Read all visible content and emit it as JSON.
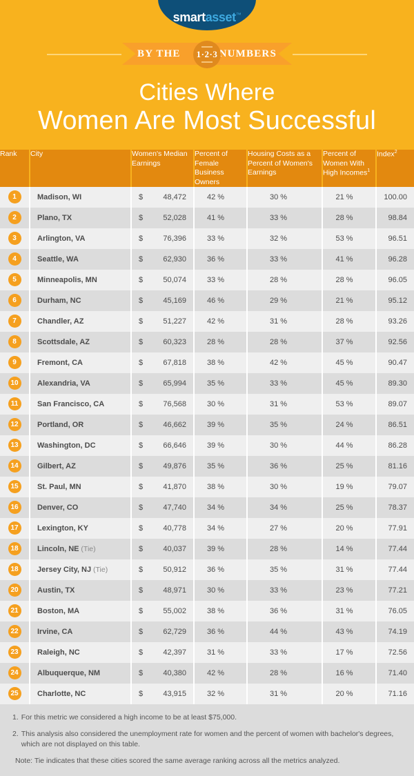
{
  "brand": {
    "logo_first": "smart",
    "logo_second": "asset",
    "logo_tm": "™",
    "navy": "#0e4f78",
    "light_blue": "#3ea9e0"
  },
  "ribbon": {
    "left_label": "BY THE",
    "right_label": "NUMBERS",
    "badge_number": "1·2·3"
  },
  "title": {
    "line1": "Cities Where",
    "line2": "Women Are Most Successful"
  },
  "table": {
    "headers": {
      "rank": "Rank",
      "city": "City",
      "earnings": "Women's Median Earnings",
      "business": "Percent of Female Business Owners",
      "housing": "Housing Costs as a Percent of Women's Earnings",
      "high_income": "Percent of Women With High Incomes",
      "high_income_sup": "1",
      "index": "Index",
      "index_sup": "2"
    },
    "currency_symbol": "$",
    "rows": [
      {
        "rank": "1",
        "city": "Madison, WI",
        "tie": "",
        "earnings": "48,472",
        "business": "42 %",
        "housing": "30 %",
        "high_income": "21 %",
        "index": "100.00"
      },
      {
        "rank": "2",
        "city": "Plano, TX",
        "tie": "",
        "earnings": "52,028",
        "business": "41 %",
        "housing": "33 %",
        "high_income": "28 %",
        "index": "98.84"
      },
      {
        "rank": "3",
        "city": "Arlington, VA",
        "tie": "",
        "earnings": "76,396",
        "business": "33 %",
        "housing": "32 %",
        "high_income": "53 %",
        "index": "96.51"
      },
      {
        "rank": "4",
        "city": "Seattle, WA",
        "tie": "",
        "earnings": "62,930",
        "business": "36 %",
        "housing": "33 %",
        "high_income": "41 %",
        "index": "96.28"
      },
      {
        "rank": "5",
        "city": "Minneapolis, MN",
        "tie": "",
        "earnings": "50,074",
        "business": "33 %",
        "housing": "28 %",
        "high_income": "28 %",
        "index": "96.05"
      },
      {
        "rank": "6",
        "city": "Durham, NC",
        "tie": "",
        "earnings": "45,169",
        "business": "46 %",
        "housing": "29 %",
        "high_income": "21 %",
        "index": "95.12"
      },
      {
        "rank": "7",
        "city": "Chandler, AZ",
        "tie": "",
        "earnings": "51,227",
        "business": "42 %",
        "housing": "31 %",
        "high_income": "28 %",
        "index": "93.26"
      },
      {
        "rank": "8",
        "city": "Scottsdale, AZ",
        "tie": "",
        "earnings": "60,323",
        "business": "28 %",
        "housing": "28 %",
        "high_income": "37 %",
        "index": "92.56"
      },
      {
        "rank": "9",
        "city": "Fremont, CA",
        "tie": "",
        "earnings": "67,818",
        "business": "38 %",
        "housing": "42 %",
        "high_income": "45 %",
        "index": "90.47"
      },
      {
        "rank": "10",
        "city": "Alexandria, VA",
        "tie": "",
        "earnings": "65,994",
        "business": "35 %",
        "housing": "33 %",
        "high_income": "45 %",
        "index": "89.30"
      },
      {
        "rank": "11",
        "city": "San Francisco, CA",
        "tie": "",
        "earnings": "76,568",
        "business": "30 %",
        "housing": "31 %",
        "high_income": "53 %",
        "index": "89.07"
      },
      {
        "rank": "12",
        "city": "Portland, OR",
        "tie": "",
        "earnings": "46,662",
        "business": "39 %",
        "housing": "35 %",
        "high_income": "24 %",
        "index": "86.51"
      },
      {
        "rank": "13",
        "city": "Washington, DC",
        "tie": "",
        "earnings": "66,646",
        "business": "39 %",
        "housing": "30 %",
        "high_income": "44 %",
        "index": "86.28"
      },
      {
        "rank": "14",
        "city": "Gilbert, AZ",
        "tie": "",
        "earnings": "49,876",
        "business": "35 %",
        "housing": "36 %",
        "high_income": "25 %",
        "index": "81.16"
      },
      {
        "rank": "15",
        "city": "St. Paul, MN",
        "tie": "",
        "earnings": "41,870",
        "business": "38 %",
        "housing": "30 %",
        "high_income": "19 %",
        "index": "79.07"
      },
      {
        "rank": "16",
        "city": "Denver, CO",
        "tie": "",
        "earnings": "47,740",
        "business": "34 %",
        "housing": "34 %",
        "high_income": "25 %",
        "index": "78.37"
      },
      {
        "rank": "17",
        "city": "Lexington, KY",
        "tie": "",
        "earnings": "40,778",
        "business": "34 %",
        "housing": "27 %",
        "high_income": "20 %",
        "index": "77.91"
      },
      {
        "rank": "18",
        "city": "Lincoln, NE",
        "tie": "(Tie)",
        "earnings": "40,037",
        "business": "39 %",
        "housing": "28 %",
        "high_income": "14 %",
        "index": "77.44"
      },
      {
        "rank": "18",
        "city": "Jersey City, NJ",
        "tie": "(Tie)",
        "earnings": "50,912",
        "business": "36 %",
        "housing": "35 %",
        "high_income": "31 %",
        "index": "77.44"
      },
      {
        "rank": "20",
        "city": "Austin, TX",
        "tie": "",
        "earnings": "48,971",
        "business": "30 %",
        "housing": "33 %",
        "high_income": "23 %",
        "index": "77.21"
      },
      {
        "rank": "21",
        "city": "Boston, MA",
        "tie": "",
        "earnings": "55,002",
        "business": "38 %",
        "housing": "36 %",
        "high_income": "31 %",
        "index": "76.05"
      },
      {
        "rank": "22",
        "city": "Irvine, CA",
        "tie": "",
        "earnings": "62,729",
        "business": "36 %",
        "housing": "44 %",
        "high_income": "43 %",
        "index": "74.19"
      },
      {
        "rank": "23",
        "city": "Raleigh, NC",
        "tie": "",
        "earnings": "42,397",
        "business": "31 %",
        "housing": "33 %",
        "high_income": "17 %",
        "index": "72.56"
      },
      {
        "rank": "24",
        "city": "Albuquerque, NM",
        "tie": "",
        "earnings": "40,380",
        "business": "42 %",
        "housing": "28 %",
        "high_income": "16 %",
        "index": "71.40"
      },
      {
        "rank": "25",
        "city": "Charlotte, NC",
        "tie": "",
        "earnings": "43,915",
        "business": "32 %",
        "housing": "31 %",
        "high_income": "20 %",
        "index": "71.16"
      }
    ]
  },
  "footnotes": [
    {
      "marker": "1.",
      "text": "For this metric we considered a high income to be at least $75,000."
    },
    {
      "marker": "2.",
      "text": "This analysis also considered the unemployment rate for women and the percent of women with bachelor's degrees, which are not displayed on this table."
    },
    {
      "marker": "",
      "text": "Note: Tie indicates that these cities scored the same average ranking across all the metrics analyzed."
    }
  ],
  "colors": {
    "background": "#f8b21e",
    "header_orange": "#e3890f",
    "ribbon_orange": "#f9a02b",
    "badge_orange": "#f5a01f",
    "row_light": "#efefef",
    "row_dark": "#dcdcdc"
  }
}
